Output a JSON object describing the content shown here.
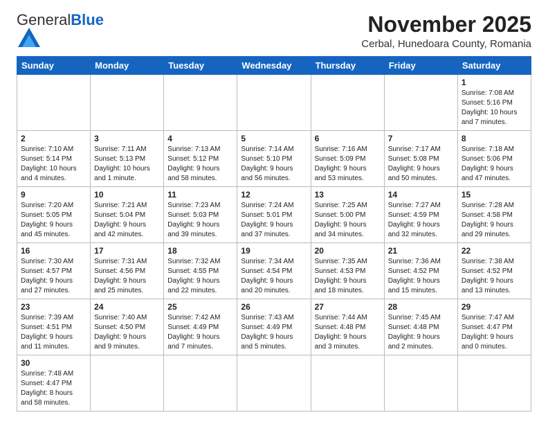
{
  "header": {
    "logo_general": "General",
    "logo_blue": "Blue",
    "title": "November 2025",
    "subtitle": "Cerbal, Hunedoara County, Romania"
  },
  "weekdays": [
    "Sunday",
    "Monday",
    "Tuesday",
    "Wednesday",
    "Thursday",
    "Friday",
    "Saturday"
  ],
  "weeks": [
    [
      {
        "day": "",
        "info": ""
      },
      {
        "day": "",
        "info": ""
      },
      {
        "day": "",
        "info": ""
      },
      {
        "day": "",
        "info": ""
      },
      {
        "day": "",
        "info": ""
      },
      {
        "day": "",
        "info": ""
      },
      {
        "day": "1",
        "info": "Sunrise: 7:08 AM\nSunset: 5:16 PM\nDaylight: 10 hours\nand 7 minutes."
      }
    ],
    [
      {
        "day": "2",
        "info": "Sunrise: 7:10 AM\nSunset: 5:14 PM\nDaylight: 10 hours\nand 4 minutes."
      },
      {
        "day": "3",
        "info": "Sunrise: 7:11 AM\nSunset: 5:13 PM\nDaylight: 10 hours\nand 1 minute."
      },
      {
        "day": "4",
        "info": "Sunrise: 7:13 AM\nSunset: 5:12 PM\nDaylight: 9 hours\nand 58 minutes."
      },
      {
        "day": "5",
        "info": "Sunrise: 7:14 AM\nSunset: 5:10 PM\nDaylight: 9 hours\nand 56 minutes."
      },
      {
        "day": "6",
        "info": "Sunrise: 7:16 AM\nSunset: 5:09 PM\nDaylight: 9 hours\nand 53 minutes."
      },
      {
        "day": "7",
        "info": "Sunrise: 7:17 AM\nSunset: 5:08 PM\nDaylight: 9 hours\nand 50 minutes."
      },
      {
        "day": "8",
        "info": "Sunrise: 7:18 AM\nSunset: 5:06 PM\nDaylight: 9 hours\nand 47 minutes."
      }
    ],
    [
      {
        "day": "9",
        "info": "Sunrise: 7:20 AM\nSunset: 5:05 PM\nDaylight: 9 hours\nand 45 minutes."
      },
      {
        "day": "10",
        "info": "Sunrise: 7:21 AM\nSunset: 5:04 PM\nDaylight: 9 hours\nand 42 minutes."
      },
      {
        "day": "11",
        "info": "Sunrise: 7:23 AM\nSunset: 5:03 PM\nDaylight: 9 hours\nand 39 minutes."
      },
      {
        "day": "12",
        "info": "Sunrise: 7:24 AM\nSunset: 5:01 PM\nDaylight: 9 hours\nand 37 minutes."
      },
      {
        "day": "13",
        "info": "Sunrise: 7:25 AM\nSunset: 5:00 PM\nDaylight: 9 hours\nand 34 minutes."
      },
      {
        "day": "14",
        "info": "Sunrise: 7:27 AM\nSunset: 4:59 PM\nDaylight: 9 hours\nand 32 minutes."
      },
      {
        "day": "15",
        "info": "Sunrise: 7:28 AM\nSunset: 4:58 PM\nDaylight: 9 hours\nand 29 minutes."
      }
    ],
    [
      {
        "day": "16",
        "info": "Sunrise: 7:30 AM\nSunset: 4:57 PM\nDaylight: 9 hours\nand 27 minutes."
      },
      {
        "day": "17",
        "info": "Sunrise: 7:31 AM\nSunset: 4:56 PM\nDaylight: 9 hours\nand 25 minutes."
      },
      {
        "day": "18",
        "info": "Sunrise: 7:32 AM\nSunset: 4:55 PM\nDaylight: 9 hours\nand 22 minutes."
      },
      {
        "day": "19",
        "info": "Sunrise: 7:34 AM\nSunset: 4:54 PM\nDaylight: 9 hours\nand 20 minutes."
      },
      {
        "day": "20",
        "info": "Sunrise: 7:35 AM\nSunset: 4:53 PM\nDaylight: 9 hours\nand 18 minutes."
      },
      {
        "day": "21",
        "info": "Sunrise: 7:36 AM\nSunset: 4:52 PM\nDaylight: 9 hours\nand 15 minutes."
      },
      {
        "day": "22",
        "info": "Sunrise: 7:38 AM\nSunset: 4:52 PM\nDaylight: 9 hours\nand 13 minutes."
      }
    ],
    [
      {
        "day": "23",
        "info": "Sunrise: 7:39 AM\nSunset: 4:51 PM\nDaylight: 9 hours\nand 11 minutes."
      },
      {
        "day": "24",
        "info": "Sunrise: 7:40 AM\nSunset: 4:50 PM\nDaylight: 9 hours\nand 9 minutes."
      },
      {
        "day": "25",
        "info": "Sunrise: 7:42 AM\nSunset: 4:49 PM\nDaylight: 9 hours\nand 7 minutes."
      },
      {
        "day": "26",
        "info": "Sunrise: 7:43 AM\nSunset: 4:49 PM\nDaylight: 9 hours\nand 5 minutes."
      },
      {
        "day": "27",
        "info": "Sunrise: 7:44 AM\nSunset: 4:48 PM\nDaylight: 9 hours\nand 3 minutes."
      },
      {
        "day": "28",
        "info": "Sunrise: 7:45 AM\nSunset: 4:48 PM\nDaylight: 9 hours\nand 2 minutes."
      },
      {
        "day": "29",
        "info": "Sunrise: 7:47 AM\nSunset: 4:47 PM\nDaylight: 9 hours\nand 0 minutes."
      }
    ],
    [
      {
        "day": "30",
        "info": "Sunrise: 7:48 AM\nSunset: 4:47 PM\nDaylight: 8 hours\nand 58 minutes."
      },
      {
        "day": "",
        "info": ""
      },
      {
        "day": "",
        "info": ""
      },
      {
        "day": "",
        "info": ""
      },
      {
        "day": "",
        "info": ""
      },
      {
        "day": "",
        "info": ""
      },
      {
        "day": "",
        "info": ""
      }
    ]
  ]
}
